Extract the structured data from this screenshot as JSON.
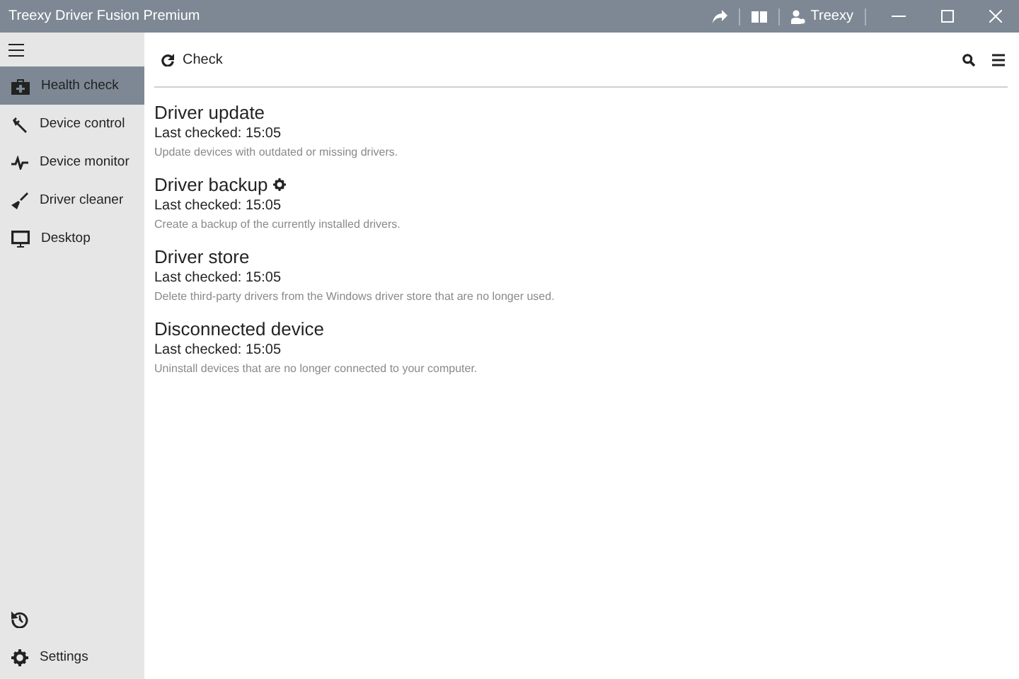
{
  "window": {
    "title": "Treexy Driver Fusion Premium",
    "account": "Treexy"
  },
  "sidebar": {
    "items": [
      {
        "label": "Health check",
        "selected": true
      },
      {
        "label": "Device control",
        "selected": false
      },
      {
        "label": "Device monitor",
        "selected": false
      },
      {
        "label": "Driver cleaner",
        "selected": false
      },
      {
        "label": "Desktop",
        "selected": false
      }
    ],
    "footer": [
      {
        "kind": "icon"
      },
      {
        "kind": "labeled",
        "label": "Settings"
      }
    ]
  },
  "toolbar": {
    "check_button": "Check"
  },
  "sections": [
    {
      "title": "Driver update",
      "checked": "Last checked: 15:05",
      "description": "Update devices with outdated or missing drivers.",
      "has_settings": false
    },
    {
      "title": "Driver backup",
      "checked": "Last checked: 15:05",
      "description": "Create a backup of the currently installed drivers.",
      "has_settings": true
    },
    {
      "title": "Driver store",
      "checked": "Last checked: 15:05",
      "description": "Delete third-party drivers from the Windows driver store that are no longer used.",
      "has_settings": false
    },
    {
      "title": "Disconnected device",
      "checked": "Last checked: 15:05",
      "description": "Uninstall devices that are no longer connected to your computer.",
      "has_settings": false
    }
  ]
}
